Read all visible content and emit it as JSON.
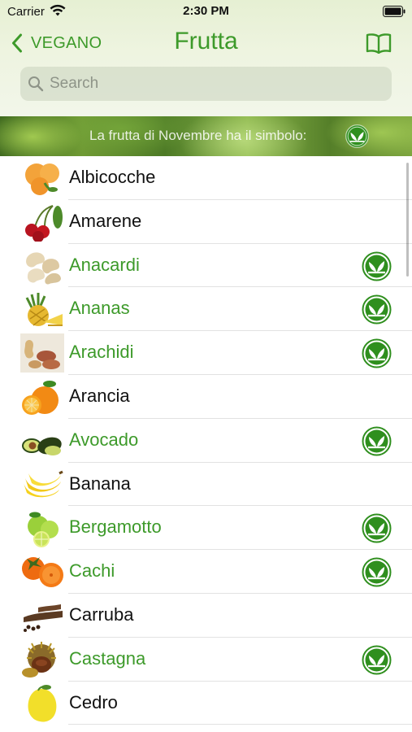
{
  "status_bar": {
    "carrier": "Carrier",
    "time": "2:30 PM"
  },
  "nav": {
    "back_label": "VEGANO",
    "title": "Frutta"
  },
  "search": {
    "placeholder": "Search"
  },
  "banner": {
    "text": "La frutta di Novembre ha il simbolo:"
  },
  "colors": {
    "accent": "#3d9a2a",
    "badge": "#2f8f1e"
  },
  "fruits": [
    {
      "name": "Albicocche",
      "in_season": false,
      "icon": "apricot-icon"
    },
    {
      "name": "Amarene",
      "in_season": false,
      "icon": "sour-cherry-icon"
    },
    {
      "name": "Anacardi",
      "in_season": true,
      "icon": "cashew-icon"
    },
    {
      "name": "Ananas",
      "in_season": true,
      "icon": "pineapple-icon"
    },
    {
      "name": "Arachidi",
      "in_season": true,
      "icon": "peanut-icon"
    },
    {
      "name": "Arancia",
      "in_season": false,
      "icon": "orange-icon"
    },
    {
      "name": "Avocado",
      "in_season": true,
      "icon": "avocado-icon"
    },
    {
      "name": "Banana",
      "in_season": false,
      "icon": "banana-icon"
    },
    {
      "name": "Bergamotto",
      "in_season": true,
      "icon": "bergamot-icon"
    },
    {
      "name": "Cachi",
      "in_season": true,
      "icon": "persimmon-icon"
    },
    {
      "name": "Carruba",
      "in_season": false,
      "icon": "carob-icon"
    },
    {
      "name": "Castagna",
      "in_season": true,
      "icon": "chestnut-icon"
    },
    {
      "name": "Cedro",
      "in_season": false,
      "icon": "citron-icon"
    }
  ]
}
